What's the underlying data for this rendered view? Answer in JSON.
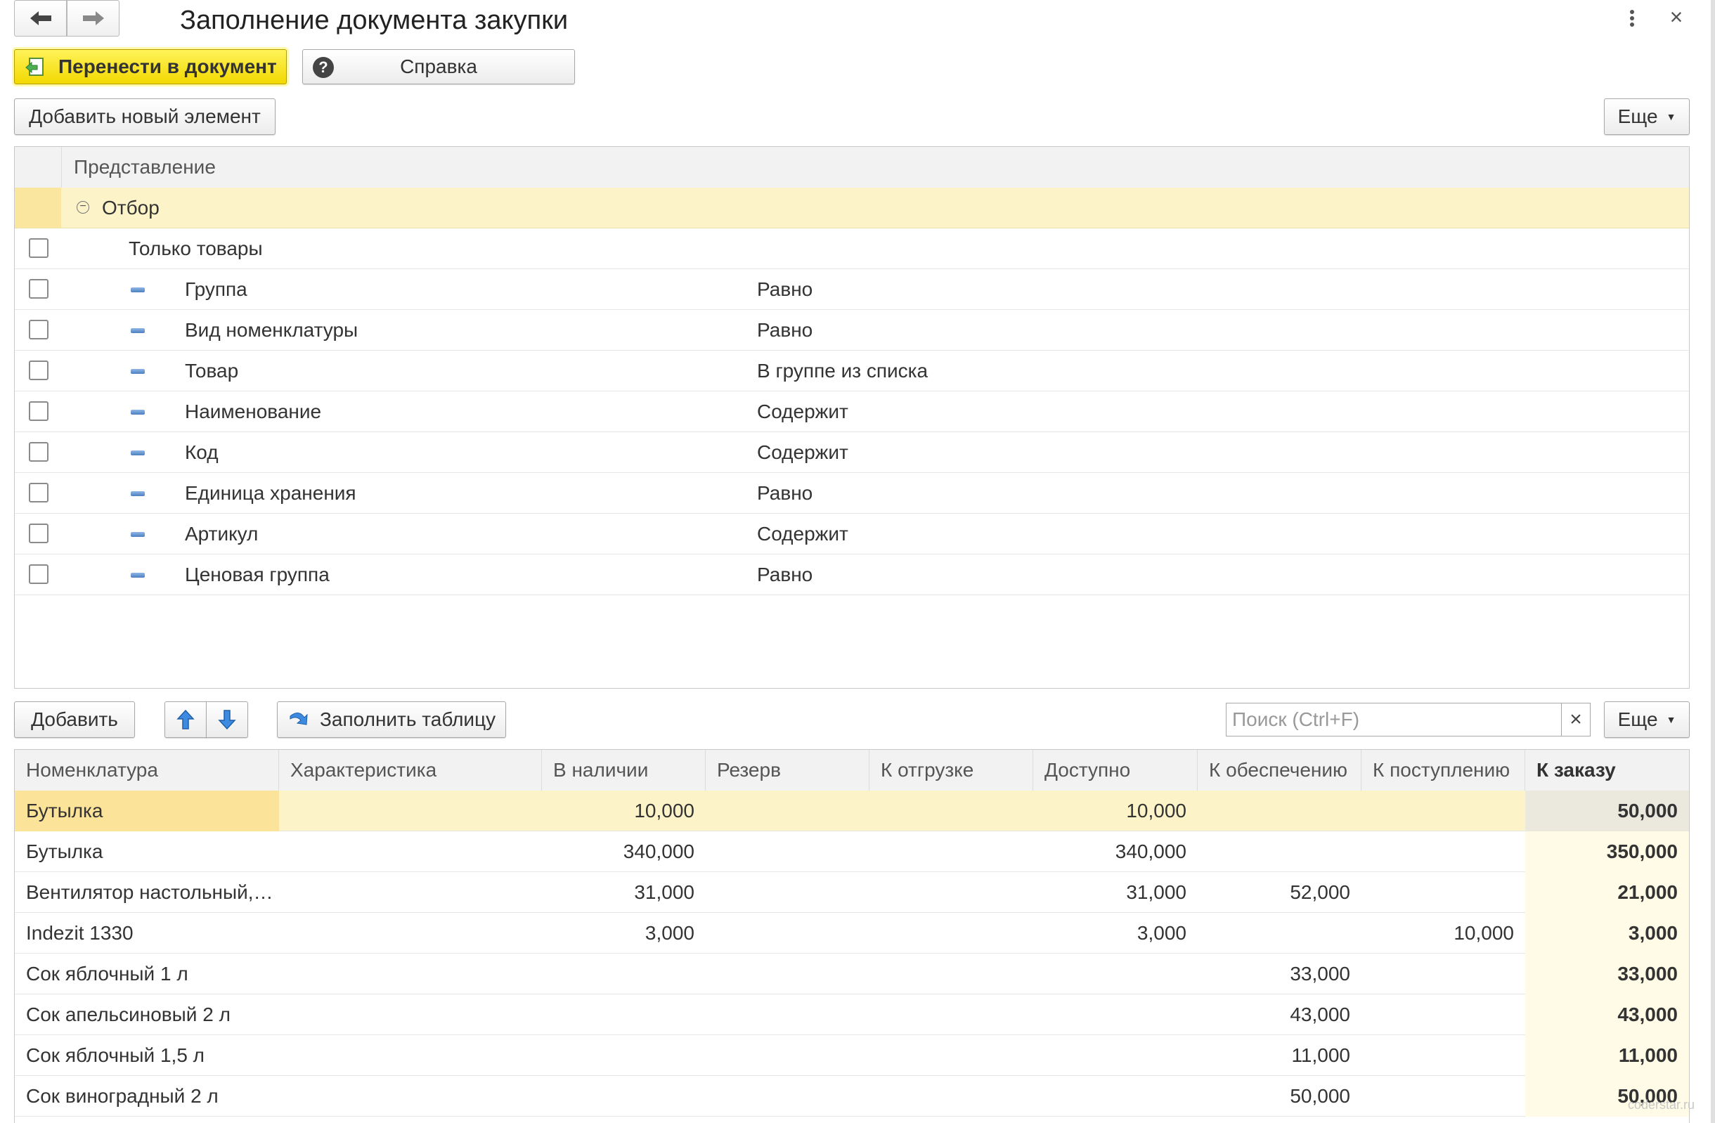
{
  "window": {
    "title": "Заполнение документа закупки"
  },
  "toolbar": {
    "transfer_label": "Перенести в документ",
    "help_label": "Справка",
    "add_new_label": "Добавить новый элемент",
    "more_label": "Еще"
  },
  "settings": {
    "header": "Представление",
    "group_label": "Отбор",
    "rows": [
      {
        "name": "Только товары",
        "condition": "",
        "nested": false
      },
      {
        "name": "Группа",
        "condition": "Равно",
        "nested": true
      },
      {
        "name": "Вид номенклатуры",
        "condition": "Равно",
        "nested": true
      },
      {
        "name": "Товар",
        "condition": "В группе из списка",
        "nested": true
      },
      {
        "name": "Наименование",
        "condition": "Содержит",
        "nested": true
      },
      {
        "name": "Код",
        "condition": "Содержит",
        "nested": true
      },
      {
        "name": "Единица хранения",
        "condition": "Равно",
        "nested": true
      },
      {
        "name": "Артикул",
        "condition": "Содержит",
        "nested": true
      },
      {
        "name": "Ценовая группа",
        "condition": "Равно",
        "nested": true
      }
    ]
  },
  "table_toolbar": {
    "add_label": "Добавить",
    "fill_label": "Заполнить таблицу",
    "search_placeholder": "Поиск (Ctrl+F)",
    "clear_symbol": "×",
    "more_label": "Еще"
  },
  "table": {
    "columns": [
      "Номенклатура",
      "Характеристика",
      "В наличии",
      "Резерв",
      "К отгрузке",
      "Доступно",
      "К обеспечению",
      "К поступлению",
      "К заказу"
    ],
    "rows": [
      [
        "Бутылка",
        "",
        "10,000",
        "",
        "",
        "10,000",
        "",
        "",
        "50,000"
      ],
      [
        "Бутылка",
        "",
        "340,000",
        "",
        "",
        "340,000",
        "",
        "",
        "350,000"
      ],
      [
        "Вентилятор настольный,…",
        "",
        "31,000",
        "",
        "",
        "31,000",
        "52,000",
        "",
        "21,000"
      ],
      [
        "Indezit 1330",
        "",
        "3,000",
        "",
        "",
        "3,000",
        "",
        "10,000",
        "3,000"
      ],
      [
        "Сок яблочный 1 л",
        "",
        "",
        "",
        "",
        "",
        "33,000",
        "",
        "33,000"
      ],
      [
        "Сок апельсиновый 2 л",
        "",
        "",
        "",
        "",
        "",
        "43,000",
        "",
        "43,000"
      ],
      [
        "Сок яблочный 1,5 л",
        "",
        "",
        "",
        "",
        "",
        "11,000",
        "",
        "11,000"
      ],
      [
        "Сок виноградный 2 л",
        "",
        "",
        "",
        "",
        "",
        "50,000",
        "",
        "50,000"
      ]
    ]
  },
  "watermark": "coderstar.ru",
  "colors": {
    "primary_button": "#f2d800",
    "selected_row": "#fdf3c8",
    "order_column": "#fffbe6"
  }
}
